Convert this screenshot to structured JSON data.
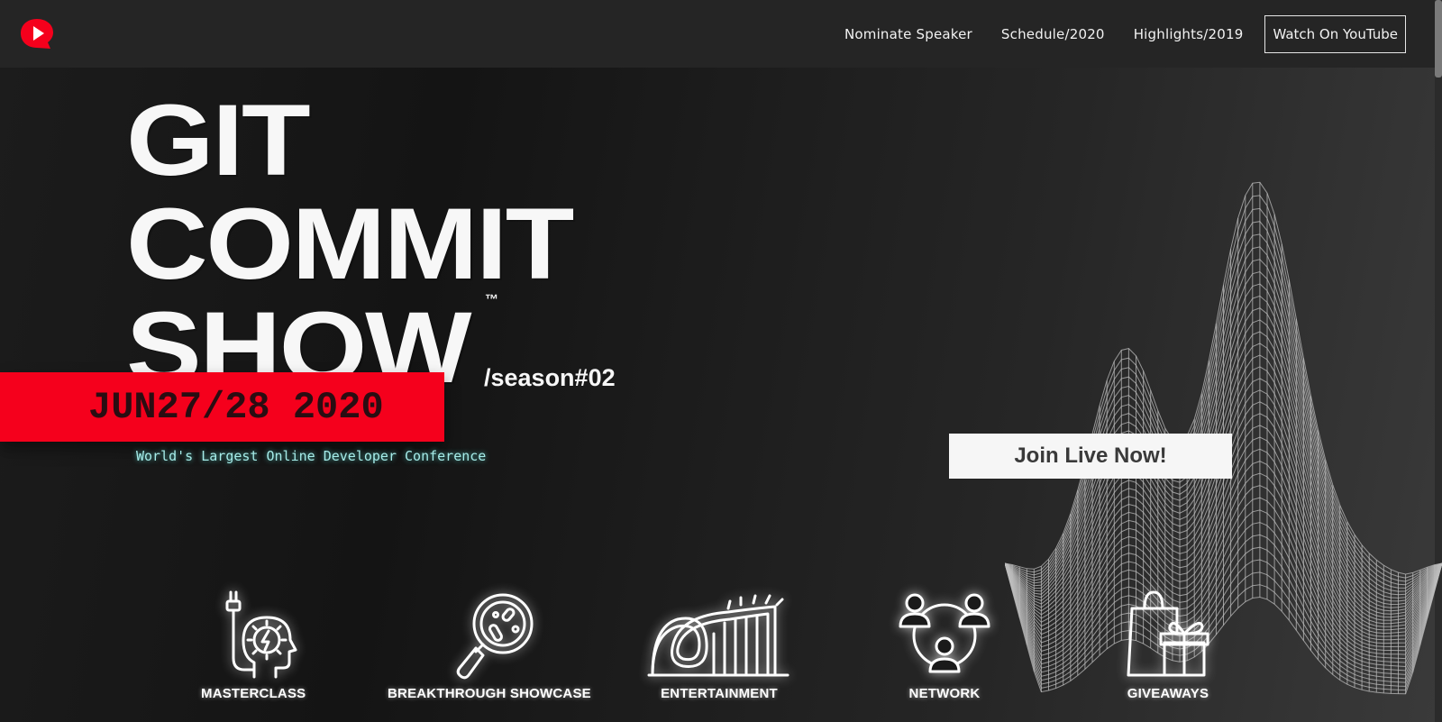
{
  "nav": {
    "logo_icon": "play-bubble-logo-icon",
    "links": [
      "Nominate Speaker",
      "Schedule/2020",
      "Highlights/2019"
    ],
    "cta_label": "Watch On YouTube"
  },
  "hero": {
    "title_lines": [
      "GIT",
      "COMMIT",
      "SHOW"
    ],
    "trademark": "™",
    "season": "/season#02",
    "date": "JUN27/28 2020",
    "subtitle": "World's Largest Online Developer Conference",
    "join_label": "Join Live Now!"
  },
  "features": [
    {
      "label": "MASTERCLASS",
      "icon": "brain-plug-icon"
    },
    {
      "label": "BREAKTHROUGH SHOWCASE",
      "icon": "magnifier-icon"
    },
    {
      "label": "ENTERTAINMENT",
      "icon": "roller-coaster-icon"
    },
    {
      "label": "NETWORK",
      "icon": "network-people-icon"
    },
    {
      "label": "GIVEAWAYS",
      "icon": "gift-bag-icon"
    }
  ],
  "colors": {
    "accent_red": "#f5001c",
    "subtitle_cyan": "#a6ece9",
    "nav_bg": "#252525",
    "background": "#141414"
  }
}
